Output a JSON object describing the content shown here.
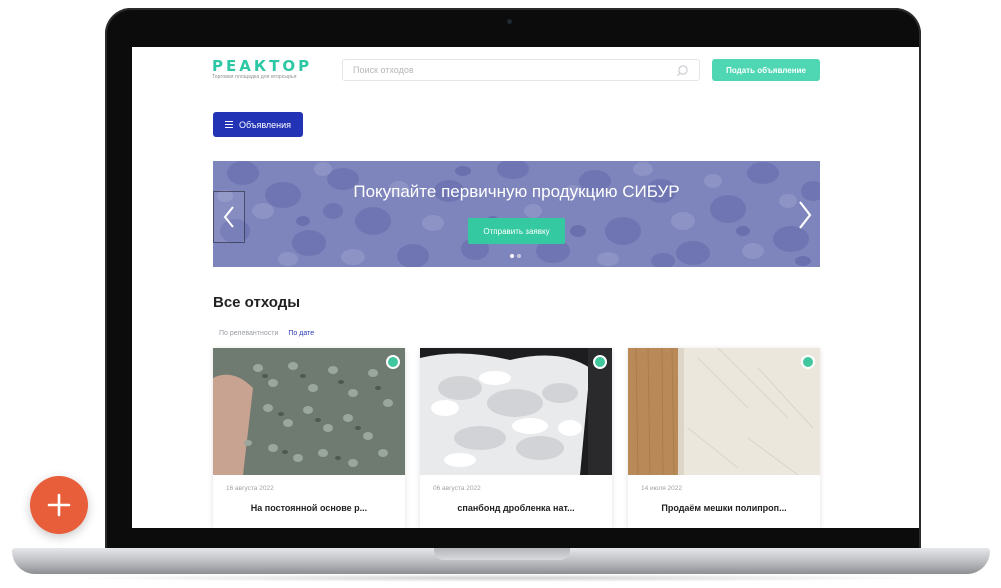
{
  "header": {
    "logo_text": "РЕАКТОР",
    "logo_tagline": "Торговая площадка для вторсырья",
    "search_placeholder": "Поиск отходов",
    "post_button_label": "Подать объявление"
  },
  "nav": {
    "ads_button_label": "Объявления"
  },
  "banner": {
    "title": "Покупайте первичную продукцию СИБУР",
    "cta_label": "Отправить заявку",
    "slides_count": 2,
    "active_slide": 1
  },
  "listings": {
    "section_title": "Все отходы",
    "sort_options": [
      "По релевантности",
      "По дате"
    ],
    "active_sort": "По дате",
    "cards": [
      {
        "date": "16 августа 2022",
        "title": "На постоянной основе р...",
        "image": "grey-green plastic pellets in hand",
        "verified": true
      },
      {
        "date": "06 августа 2022",
        "title": "спанбонд дробленка нат...",
        "image": "white shredded spunbond fibers",
        "verified": true
      },
      {
        "date": "14 июля 2022",
        "title": "Продаём мешки полипроп...",
        "image": "polypropylene woven bag",
        "verified": true
      }
    ]
  },
  "icons": {
    "search": "search-icon",
    "menu": "menu-icon",
    "prev": "chevron-left-icon",
    "next": "chevron-right-icon",
    "verified": "verified-badge-icon",
    "add": "plus-icon"
  },
  "colors": {
    "brand": "#2cc7a4",
    "primary_button": "#4fd7b3",
    "ads_button": "#2233b5",
    "fab": "#e85d3a"
  }
}
